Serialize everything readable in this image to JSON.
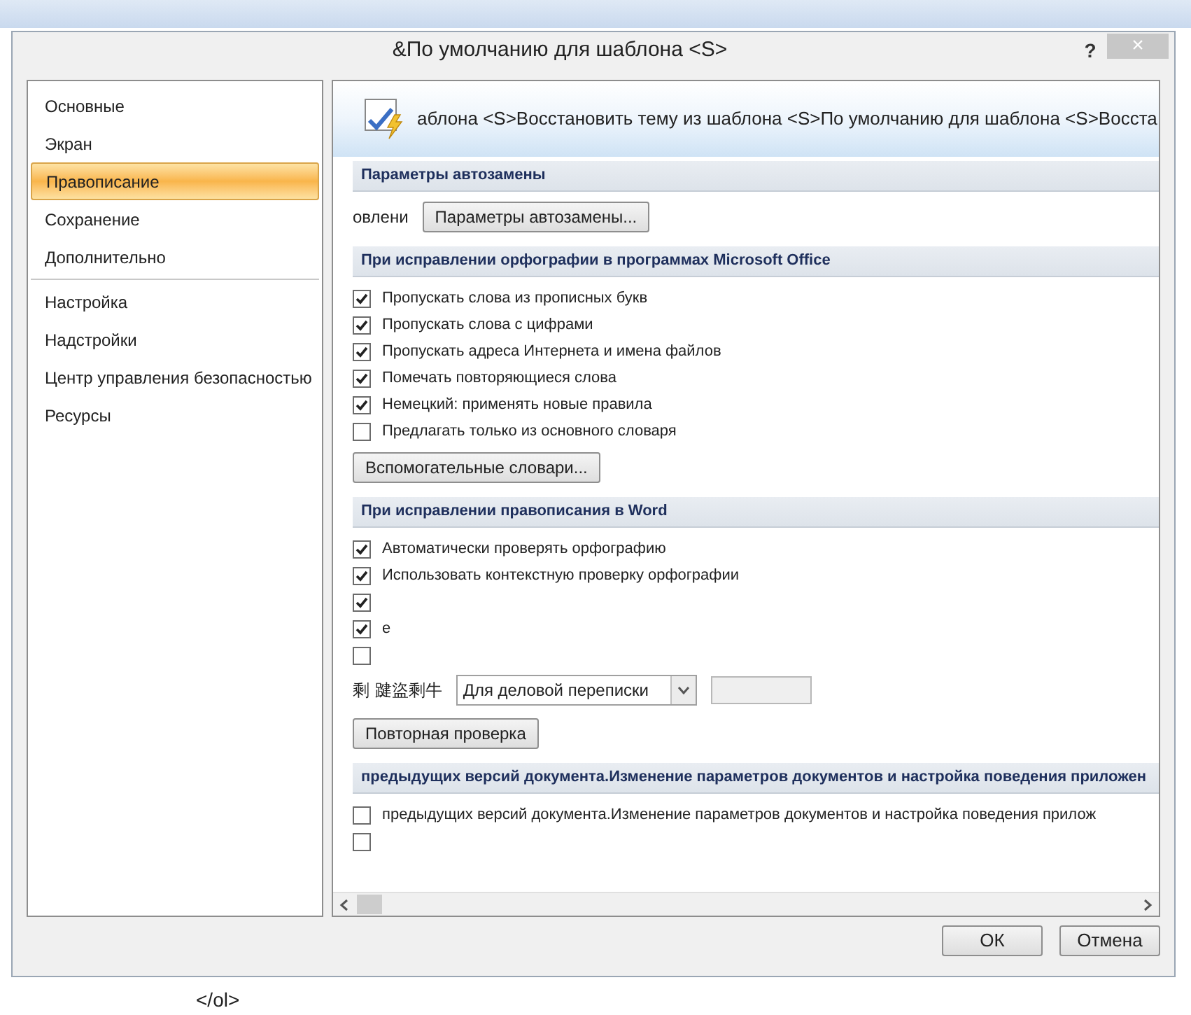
{
  "dialog": {
    "title": "&По умолчанию для шаблона <S>",
    "help": "?",
    "close": "×"
  },
  "sidebar": {
    "groups": [
      [
        {
          "label": "Основные",
          "selected": false
        },
        {
          "label": "Экран",
          "selected": false
        },
        {
          "label": "Правописание",
          "selected": true
        },
        {
          "label": "Сохранение",
          "selected": false
        },
        {
          "label": "Дополнительно",
          "selected": false
        }
      ],
      [
        {
          "label": "Настройка",
          "selected": false
        },
        {
          "label": "Надстройки",
          "selected": false
        },
        {
          "label": "Центр управления безопасностью",
          "selected": false
        },
        {
          "label": "Ресурсы",
          "selected": false
        }
      ]
    ]
  },
  "banner": {
    "text": "аблона <S>Восстановить тему из шаблона <S>По умолчанию для шаблона <S>Восста"
  },
  "sections": [
    {
      "title": "Параметры автозамены",
      "items": [
        {
          "kind": "button_row",
          "label": "овлени",
          "button": "Параметры автозамены..."
        }
      ]
    },
    {
      "title": "При исправлении орфографии в программах Microsoft Office",
      "items": [
        {
          "kind": "checkbox",
          "label": "Пропускать слова из прописных букв",
          "checked": true
        },
        {
          "kind": "checkbox",
          "label": "Пропускать слова с цифрами",
          "checked": true
        },
        {
          "kind": "checkbox",
          "label": "Пропускать адреса Интернета и имена файлов",
          "checked": true
        },
        {
          "kind": "checkbox",
          "label": "Помечать повторяющиеся слова",
          "checked": true
        },
        {
          "kind": "checkbox",
          "label": "Немецкий: применять новые правила",
          "checked": true
        },
        {
          "kind": "checkbox",
          "label": "Предлагать только из основного словаря",
          "checked": false
        },
        {
          "kind": "button",
          "button": "Вспомогательные словари..."
        }
      ]
    },
    {
      "title": "При исправлении правописания в Word",
      "items": [
        {
          "kind": "checkbox",
          "label": "Автоматически проверять орфографию",
          "checked": true
        },
        {
          "kind": "checkbox",
          "label": "Использовать контекстную проверку орфографии",
          "checked": true
        },
        {
          "kind": "checkbox",
          "checked": true
        },
        {
          "kind": "checkbox",
          "label": "е",
          "checked": true
        },
        {
          "kind": "checkbox",
          "checked": false
        },
        {
          "kind": "dropdown",
          "label": "剩 踺盜剩牛",
          "value": "Для деловой переписки"
        },
        {
          "kind": "button",
          "button": "Повторная проверка"
        }
      ]
    },
    {
      "title": "предыдущих версий документа.Изменение параметров документов и настройка поведения приложен",
      "items": [
        {
          "kind": "checkbox",
          "label": "предыдущих версий документа.Изменение параметров документов и настройка поведения прилож",
          "checked": false
        },
        {
          "kind": "checkbox",
          "checked": false
        }
      ]
    }
  ],
  "footer": {
    "buttons": [
      "ОК",
      "Отмена"
    ]
  },
  "background": {
    "text": "</ol>"
  }
}
